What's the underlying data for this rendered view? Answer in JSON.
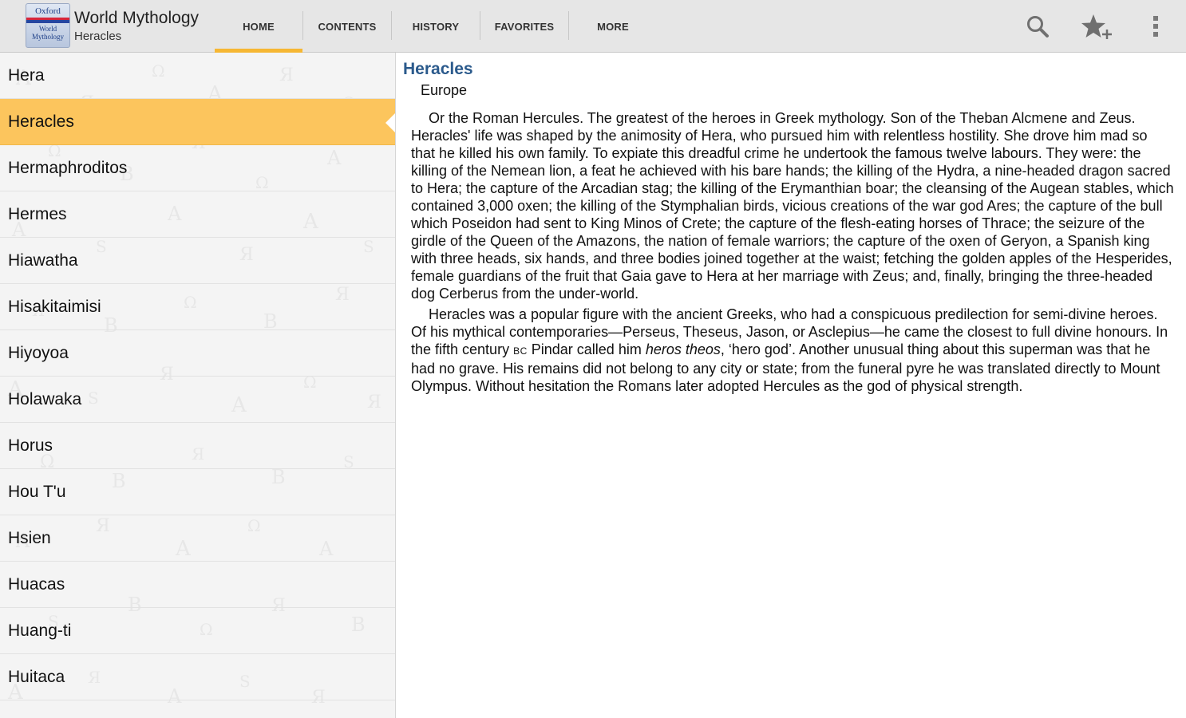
{
  "header": {
    "logo": {
      "line1": "Oxford",
      "line2": "World",
      "line3": "Mythology"
    },
    "title": "World Mythology",
    "subtitle": "Heracles"
  },
  "tabs": [
    {
      "label": "HOME",
      "active": true
    },
    {
      "label": "CONTENTS",
      "active": false
    },
    {
      "label": "HISTORY",
      "active": false
    },
    {
      "label": "FAVORITES",
      "active": false
    },
    {
      "label": "MORE",
      "active": false
    }
  ],
  "toolbar_icons": [
    "search-icon",
    "star-add-icon",
    "overflow-menu-icon"
  ],
  "colors": {
    "accent": "#f6b733",
    "selected_row": "#fcc55d",
    "title_blue": "#2b5a8c"
  },
  "entries": [
    "Hera",
    "Heracles",
    "Hermaphroditos",
    "Hermes",
    "Hiawatha",
    "Hisakitaimisi",
    "Hiyoyoa",
    "Holawaka",
    "Horus",
    "Hou T'u",
    "Hsien",
    "Huacas",
    "Huang-ti",
    "Huitaca"
  ],
  "selected_entry": "Heracles",
  "article": {
    "title": "Heracles",
    "region": "Europe",
    "p1": "Or the Roman Hercules. The greatest of the heroes in Greek mythology. Son of the Theban Alcmene and Zeus. Heracles' life was shaped by the animosity of Hera, who pursued him with relentless hostility. She drove him mad so that he killed his own family. To expiate this dreadful crime he undertook the famous twelve labours. They were: the killing of the Nemean lion, a feat he achieved with his bare hands; the killing of the Hydra, a nine-headed dragon sacred to Hera; the capture of the Arcadian stag; the killing of the Erymanthian boar; the cleansing of the Augean stables, which contained 3,000 oxen; the killing of the Stymphalian birds, vicious creations of the war god Ares; the capture of the bull which Poseidon had sent to King Minos of Crete; the capture of the flesh-eating horses of Thrace; the seizure of the girdle of the Queen of the Amazons, the nation of female warriors; the capture of the oxen of Geryon, a Spanish king with three heads, six hands, and three bodies joined together at the waist; fetching the golden apples of the Hesperides, female guardians of the fruit that Gaia gave to Hera at her marriage with Zeus; and, finally, bringing the three-headed dog Cerberus from the under-world.",
    "p2_a": "Heracles was a popular figure with the ancient Greeks, who had a conspicuous predilection for semi-divine heroes. Of his mythical contemporaries—Perseus, Theseus, Jason, or Asclepius—he came the closest to full divine honours. In the fifth century ",
    "p2_era": "BC",
    "p2_b": " Pindar called him ",
    "p2_em": "heros theos",
    "p2_c": ", ‘hero god’. Another unusual thing about this superman was that he had no grave. His remains did not belong to any city or state; from the funeral pyre he was translated directly to Mount Olympus. Without hesitation the Romans later adopted Hercules as the god of physical strength."
  }
}
